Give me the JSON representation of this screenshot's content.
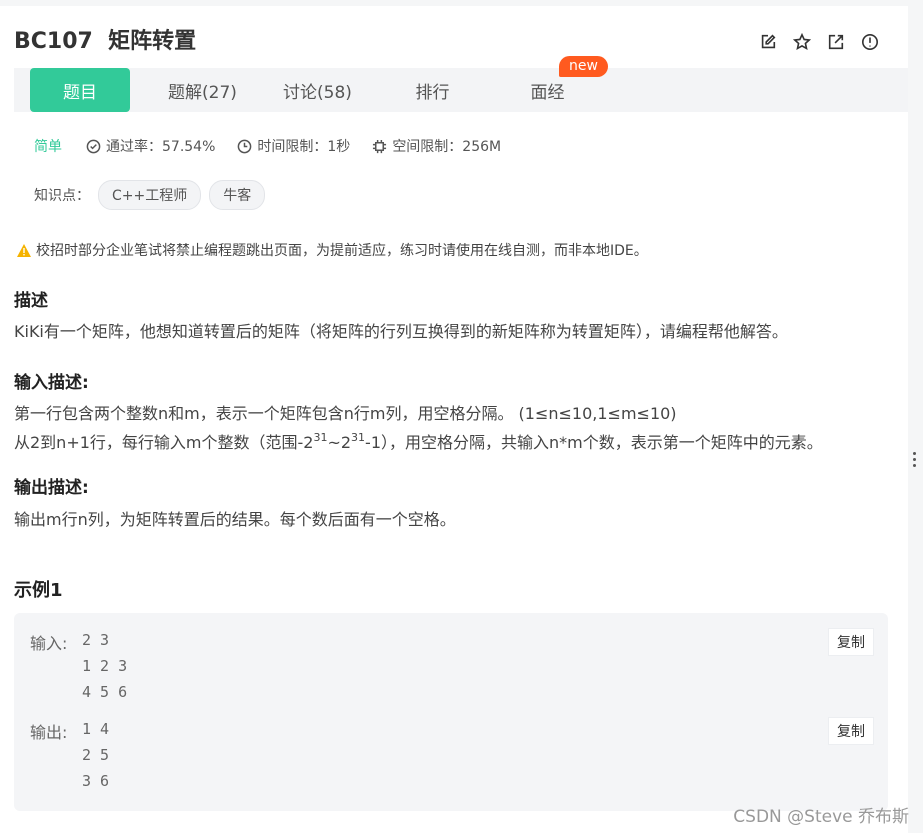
{
  "problem": {
    "code": "BC107",
    "name": "矩阵转置"
  },
  "tabs": [
    {
      "label": "题目"
    },
    {
      "label": "题解(27)"
    },
    {
      "label": "讨论(58)"
    },
    {
      "label": "排行"
    },
    {
      "label": "面经"
    }
  ],
  "badge_new": "new",
  "meta": {
    "difficulty": "简单",
    "pass_rate": "通过率：57.54%",
    "time_limit": "时间限制：1秒",
    "space_limit": "空间限制：256M"
  },
  "knowledge": {
    "label": "知识点：",
    "tags": [
      "C++工程师",
      "牛客"
    ]
  },
  "warning": "校招时部分企业笔试将禁止编程题跳出页面，为提前适应，练习时请使用在线自测，而非本地IDE。",
  "description": {
    "heading": "描述",
    "text": "KiKi有一个矩阵，他想知道转置后的矩阵（将矩阵的行列互换得到的新矩阵称为转置矩阵），请编程帮他解答。"
  },
  "input_desc": {
    "heading": "输入描述:",
    "line1": "第一行包含两个整数n和m，表示一个矩阵包含n行m列，用空格分隔。 (1≤n≤10,1≤m≤10)",
    "line2_a": "从2到n+1行，每行输入m个整数（范围-2",
    "line2_sup1": "31",
    "line2_b": "~2",
    "line2_sup2": "31",
    "line2_c": "-1），用空格分隔，共输入n*m个数，表示第一个矩阵中的元素。"
  },
  "output_desc": {
    "heading": "输出描述:",
    "text": "输出m行n列，为矩阵转置后的结果。每个数后面有一个空格。"
  },
  "example": {
    "heading": "示例1",
    "input_label": "输入:",
    "input_value": "2 3\n1 2 3\n4 5 6",
    "output_label": "输出:",
    "output_value": "1 4\n2 5\n3 6",
    "copy_label": "复制"
  },
  "watermark": "CSDN @Steve 乔布斯",
  "icons": [
    "edit-icon",
    "star-icon",
    "share-icon",
    "report-icon",
    "check-circle-icon",
    "clock-icon",
    "chip-icon",
    "warning-icon"
  ],
  "colors": {
    "accent": "#32ca99",
    "new_badge": "#ff5a1f",
    "warning": "#f5b300"
  }
}
